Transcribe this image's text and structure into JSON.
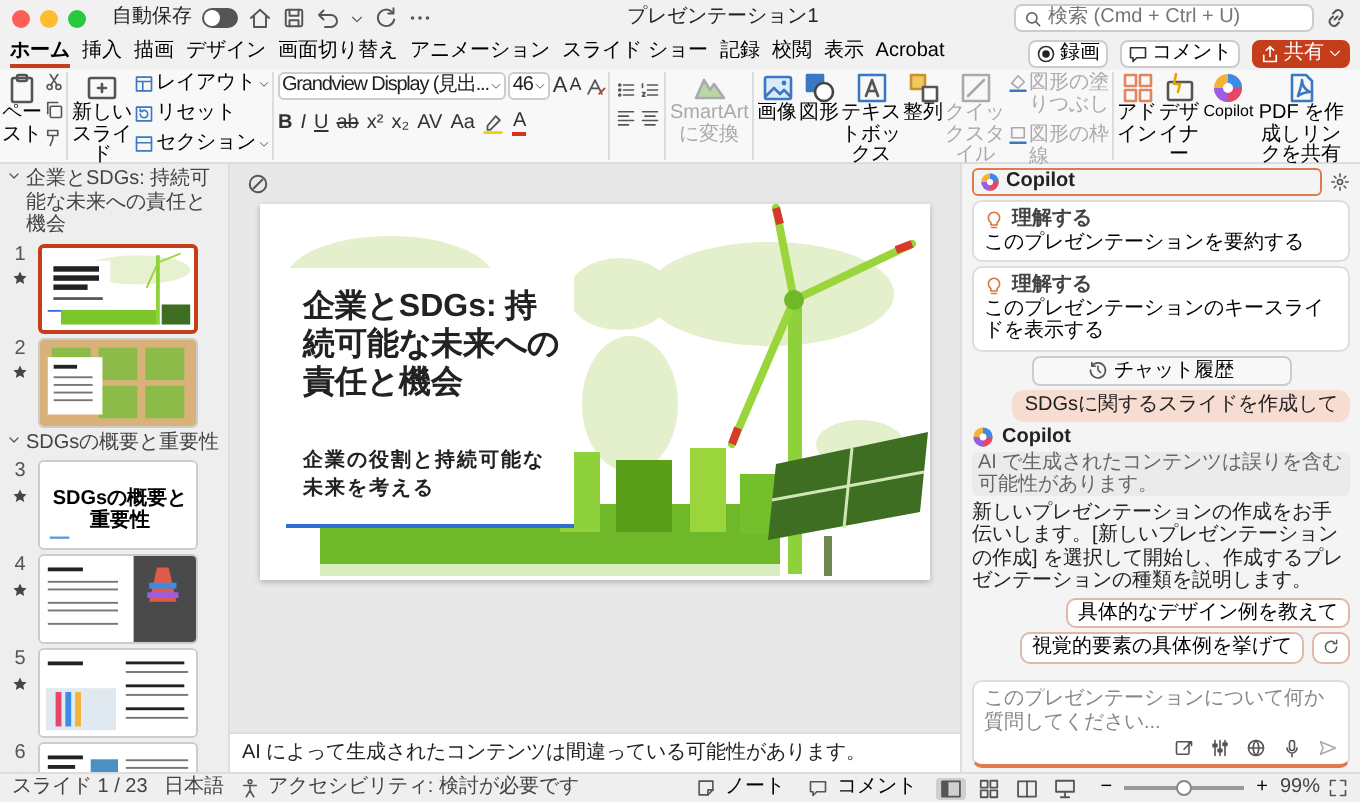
{
  "window": {
    "title": "プレゼンテーション1",
    "autosave": {
      "label": "自動保存",
      "on": false
    },
    "search": {
      "placeholder": "検索 (Cmd + Ctrl + U)"
    }
  },
  "tabs": [
    {
      "label": "ホーム",
      "selected": true
    },
    {
      "label": "挿入",
      "selected": false
    },
    {
      "label": "描画",
      "selected": false
    },
    {
      "label": "デザイン",
      "selected": false
    },
    {
      "label": "画面切り替え",
      "selected": false
    },
    {
      "label": "アニメーション",
      "selected": false
    },
    {
      "label": "スライド ショー",
      "selected": false
    },
    {
      "label": "記録",
      "selected": false
    },
    {
      "label": "校閲",
      "selected": false
    },
    {
      "label": "表示",
      "selected": false
    },
    {
      "label": "Acrobat",
      "selected": false
    }
  ],
  "header_buttons": [
    {
      "kind": "record",
      "label": "録画"
    },
    {
      "kind": "comment",
      "label": "コメント"
    },
    {
      "kind": "share",
      "label": "共有"
    }
  ],
  "ribbon": {
    "paste": "ペースト",
    "new_slide": "新しいスライド",
    "slide_commands": [
      "レイアウト",
      "リセット",
      "セクション"
    ],
    "font_name": "Grandview Display (見出...",
    "font_size": "46",
    "font_size_buttons": [
      "A",
      "A"
    ],
    "format_buttons": [
      {
        "kind": "bold",
        "label": "B"
      },
      {
        "kind": "italic",
        "label": "I"
      },
      {
        "kind": "underline",
        "label": "U"
      },
      {
        "kind": "strike",
        "label": "ab"
      },
      {
        "kind": "plain",
        "label": "x²"
      },
      {
        "kind": "plain",
        "label": "x₂"
      },
      {
        "kind": "plain",
        "label": "AV"
      },
      {
        "kind": "plain",
        "label": "Aa"
      },
      {
        "kind": "color",
        "label": "A"
      }
    ],
    "smartart": {
      "label": "SmartArt に変換",
      "disabled": true
    },
    "big_buttons": [
      {
        "kind": "picture",
        "label": "画像",
        "disabled": false
      },
      {
        "kind": "shapes",
        "label": "図形",
        "disabled": false
      },
      {
        "kind": "textbox",
        "label": "テキストボックス",
        "disabled": false
      },
      {
        "kind": "arrange",
        "label": "整列",
        "disabled": false
      },
      {
        "kind": "quickstyle",
        "label": "クイックスタイル",
        "disabled": true
      }
    ],
    "shape_commands": [
      {
        "kind": "fill",
        "label": "図形の塗りつぶし",
        "disabled": true
      },
      {
        "kind": "outline",
        "label": "図形の枠線",
        "disabled": true
      }
    ],
    "apps": [
      {
        "kind": "addins",
        "label": "アドイン"
      },
      {
        "kind": "designer",
        "label": "デザイナー"
      },
      {
        "kind": "copilot",
        "label": "Copilot"
      },
      {
        "kind": "pdf",
        "label": "PDF を作成しリンクを共有"
      }
    ]
  },
  "slide_sections": [
    {
      "title": "企業とSDGs: 持続可能な未来への責任と機会",
      "expanded": true,
      "slides": [
        {
          "number": "1",
          "kind": "title",
          "selected": true
        },
        {
          "number": "2",
          "kind": "agenda",
          "selected": false
        }
      ]
    },
    {
      "title": "SDGsの概要と重要性",
      "expanded": true,
      "slides": [
        {
          "number": "3",
          "kind": "section",
          "selected": false,
          "text": "SDGsの概要と重要性"
        },
        {
          "number": "4",
          "kind": "text_image",
          "selected": false
        },
        {
          "number": "5",
          "kind": "text_image2",
          "selected": false
        },
        {
          "number": "6",
          "kind": "text_chart",
          "selected": false
        }
      ]
    }
  ],
  "slide": {
    "title": "企業とSDGs: 持続可能な未来への責任と機会",
    "subtitle": "企業の役割と持続可能な未来を考える"
  },
  "notes": "AI によって生成されたコンテンツは間違っている可能性があります。",
  "copilot": {
    "title": "Copilot",
    "prompts": [
      {
        "category": "理解する",
        "text": "このプレゼンテーションを要約する"
      },
      {
        "category": "理解する",
        "text": "このプレゼンテーションのキースライドを表示する"
      }
    ],
    "history_button": "チャット履歴",
    "user_message": "SDGsに関するスライドを作成して",
    "assistant": {
      "name": "Copilot",
      "disclaimer": "AI で生成されたコンテンツは誤りを含む可能性があります。",
      "text": "新しいプレゼンテーションの作成をお手伝いします。[新しいプレゼンテーションの作成] を選択して開始し、作成するプレゼンテーションの種類を説明します。"
    },
    "suggestions": [
      "具体的なデザイン例を教えて",
      "視覚的要素の具体例を挙げて"
    ],
    "input": {
      "placeholder": "このプレゼンテーションについて何か質問してください..."
    }
  },
  "status_bar": {
    "slide_position": "スライド 1 / 23",
    "language": "日本語",
    "accessibility": "アクセシビリティ: 検討が必要です",
    "notes": "ノート",
    "comments": "コメント",
    "views": [
      {
        "kind": "normal",
        "selected": true
      },
      {
        "kind": "sorter",
        "selected": false
      },
      {
        "kind": "reading",
        "selected": false
      },
      {
        "kind": "presenter",
        "selected": false
      }
    ],
    "zoom": {
      "minus": "−",
      "plus": "+",
      "level": 0.5,
      "reading": "99%"
    }
  }
}
